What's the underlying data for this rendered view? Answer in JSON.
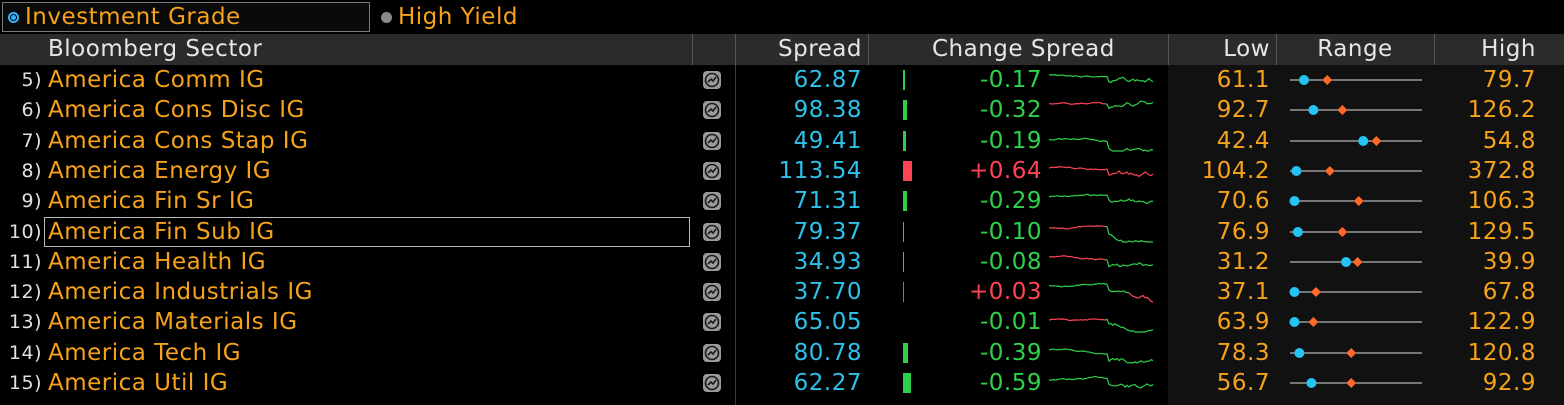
{
  "tabs": {
    "investment_grade": "Investment Grade",
    "high_yield": "High Yield",
    "selected": "investment_grade"
  },
  "headers": {
    "sector": "Bloomberg Sector",
    "spread": "Spread",
    "change_spread": "Change Spread",
    "low": "Low",
    "range": "Range",
    "high": "High"
  },
  "colors": {
    "orange": "#f7a21b",
    "cyan": "#2fc1ea",
    "green": "#2fd14b",
    "red": "#ff4455"
  },
  "selected_row": 5,
  "rows": [
    {
      "num": "5)",
      "name": "America Comm IG",
      "spread": "62.87",
      "change": "-0.17",
      "change_val": -0.17,
      "low": "61.1",
      "high": "79.7",
      "low_v": 61.1,
      "high_v": 79.7,
      "cur_v": 62.87,
      "avg_frac": 0.28,
      "spark": "g"
    },
    {
      "num": "6)",
      "name": "America Cons Disc IG",
      "spread": "98.38",
      "change": "-0.32",
      "change_val": -0.32,
      "low": "92.7",
      "high": "126.2",
      "low_v": 92.7,
      "high_v": 126.2,
      "cur_v": 98.38,
      "avg_frac": 0.4,
      "spark": "rg"
    },
    {
      "num": "7)",
      "name": "America Cons Stap IG",
      "spread": "49.41",
      "change": "-0.19",
      "change_val": -0.19,
      "low": "42.4",
      "high": "54.8",
      "low_v": 42.4,
      "high_v": 54.8,
      "cur_v": 49.41,
      "avg_frac": 0.67,
      "spark": "g"
    },
    {
      "num": "8)",
      "name": "America Energy IG",
      "spread": "113.54",
      "change": "+0.64",
      "change_val": 0.64,
      "low": "104.2",
      "high": "372.8",
      "low_v": 104.2,
      "high_v": 372.8,
      "cur_v": 113.54,
      "avg_frac": 0.3,
      "spark": "r"
    },
    {
      "num": "9)",
      "name": "America Fin Sr IG",
      "spread": "71.31",
      "change": "-0.29",
      "change_val": -0.29,
      "low": "70.6",
      "high": "106.3",
      "low_v": 70.6,
      "high_v": 106.3,
      "cur_v": 71.31,
      "avg_frac": 0.53,
      "spark": "g"
    },
    {
      "num": "10)",
      "name": "America Fin Sub IG",
      "spread": "79.37",
      "change": "-0.10",
      "change_val": -0.1,
      "low": "76.9",
      "high": "129.5",
      "low_v": 76.9,
      "high_v": 129.5,
      "cur_v": 79.37,
      "avg_frac": 0.4,
      "spark": "rg"
    },
    {
      "num": "11)",
      "name": "America Health IG",
      "spread": "34.93",
      "change": "-0.08",
      "change_val": -0.08,
      "low": "31.2",
      "high": "39.9",
      "low_v": 31.2,
      "high_v": 39.9,
      "cur_v": 34.93,
      "avg_frac": 0.52,
      "spark": "rg"
    },
    {
      "num": "12)",
      "name": "America Industrials IG",
      "spread": "37.70",
      "change": "+0.03",
      "change_val": 0.03,
      "low": "37.1",
      "high": "67.8",
      "low_v": 37.1,
      "high_v": 67.8,
      "cur_v": 37.7,
      "avg_frac": 0.19,
      "spark": "gr"
    },
    {
      "num": "13)",
      "name": "America Materials IG",
      "spread": "65.05",
      "change": "-0.01",
      "change_val": -0.01,
      "low": "63.9",
      "high": "122.9",
      "low_v": 63.9,
      "high_v": 122.9,
      "cur_v": 65.05,
      "avg_frac": 0.17,
      "spark": "rg"
    },
    {
      "num": "14)",
      "name": "America Tech IG",
      "spread": "80.78",
      "change": "-0.39",
      "change_val": -0.39,
      "low": "78.3",
      "high": "120.8",
      "low_v": 78.3,
      "high_v": 120.8,
      "cur_v": 80.78,
      "avg_frac": 0.47,
      "spark": "g"
    },
    {
      "num": "15)",
      "name": "America Util IG",
      "spread": "62.27",
      "change": "-0.59",
      "change_val": -0.59,
      "low": "56.7",
      "high": "92.9",
      "low_v": 56.7,
      "high_v": 92.9,
      "cur_v": 62.27,
      "avg_frac": 0.47,
      "spark": "g"
    }
  ]
}
